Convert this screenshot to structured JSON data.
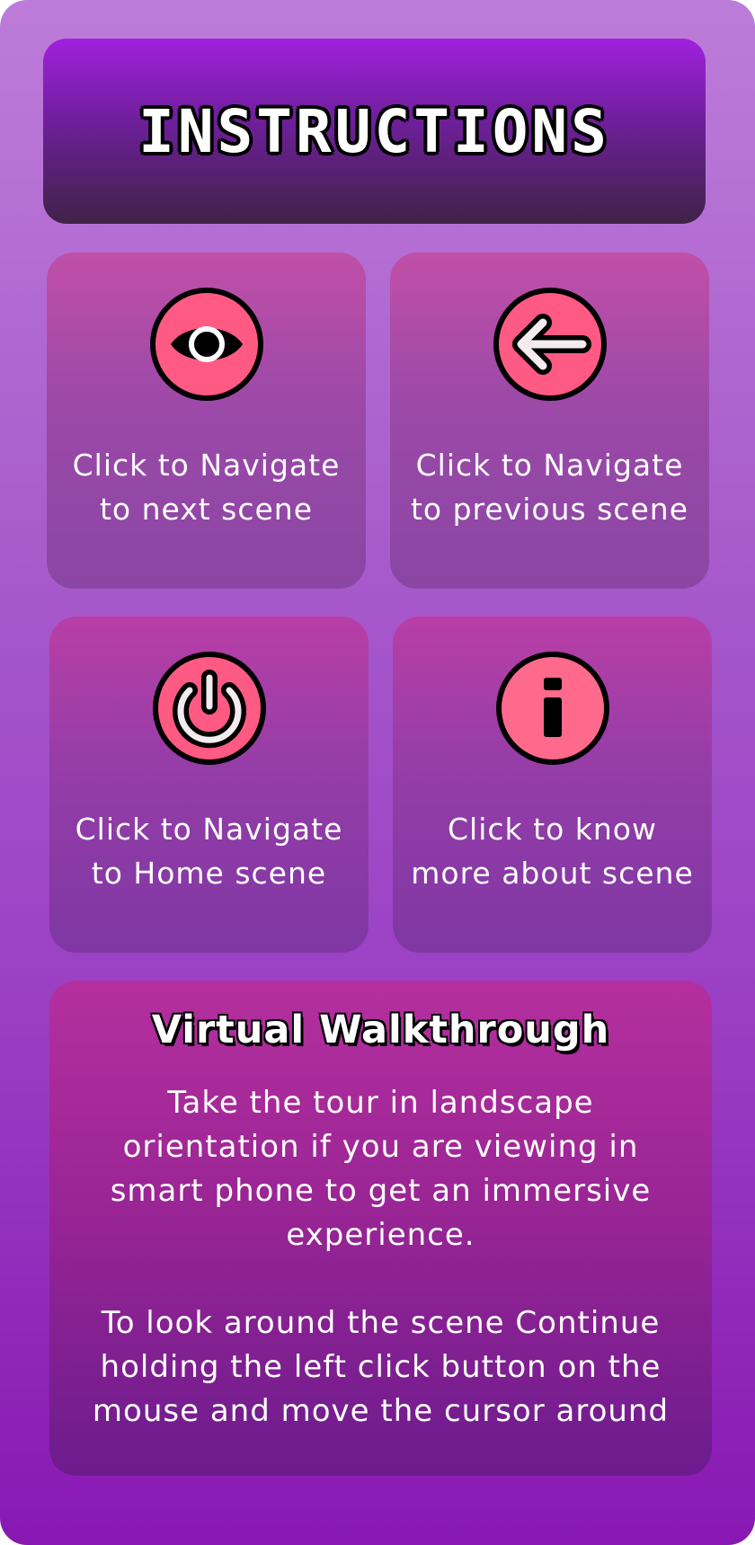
{
  "header": {
    "title": "INSTRUCTIONS"
  },
  "cards": [
    {
      "icon": "eye-icon",
      "line1": "Click to Navigate",
      "line2": "to next scene"
    },
    {
      "icon": "arrow-left-icon",
      "line1": "Click to Navigate",
      "line2": "to previous scene"
    },
    {
      "icon": "power-icon",
      "line1": "Click to Navigate",
      "line2": "to Home scene"
    },
    {
      "icon": "info-icon",
      "line1": "Click to know",
      "line2": "more about scene"
    }
  ],
  "walkthrough": {
    "title": "Virtual Walkthrough",
    "paragraph1": [
      "Take the tour in landscape",
      "orientation if you are viewing in",
      "smart phone to get an immersive",
      "experience."
    ],
    "paragraph2": [
      "To look around the scene Continue",
      "holding the left click button on the",
      "mouse and move the cursor around"
    ]
  },
  "colors": {
    "icon_fill": "#ff5a84",
    "icon_outline": "#000000",
    "icon_glyph_light": "#f2ecef"
  }
}
